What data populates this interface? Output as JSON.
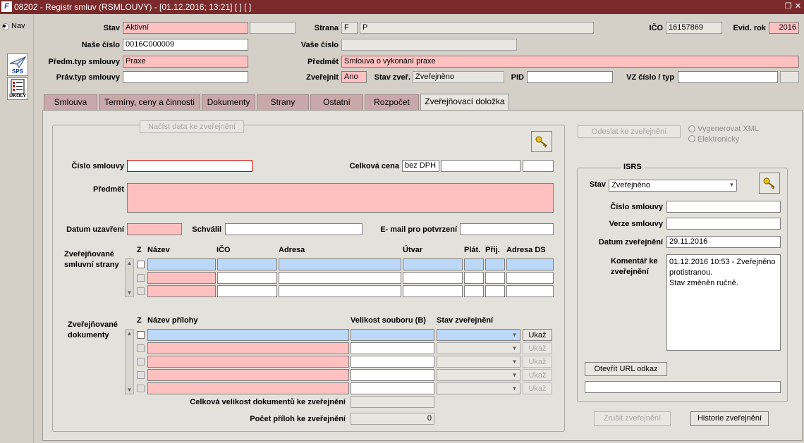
{
  "window": {
    "title": "08202 - Registr smluv (RSMLOUVY) - [01.12.2016; 13:21] [ ] [ ]",
    "app_icon_text": "F"
  },
  "left": {
    "nav_label": "Nav",
    "sps_label": "SPS",
    "ukoly_label": "ÚKOLY"
  },
  "header": {
    "stav_label": "Stav",
    "stav_value": "Aktivní",
    "strana_label": "Strana",
    "strana_code": "F",
    "strana_value": "P",
    "ico_label": "IČO",
    "ico_value": "16157869",
    "evid_rok_label": "Evid. rok",
    "evid_rok_value": "2016",
    "nase_cislo_label": "Naše číslo",
    "nase_cislo_value": "0016C000009",
    "vase_cislo_label": "Vaše číslo",
    "predm_typ_label": "Předm.typ smlouvy",
    "predm_typ_value": "Praxe",
    "predmet_label": "Předmět",
    "predmet_value": "Smlouva o vykonání praxe",
    "prav_typ_label": "Práv.typ smlouvy",
    "zverejnit_label": "Zveřejnit",
    "zverejnit_value": "Ano",
    "stav_zver_label": "Stav zveř.",
    "stav_zver_value": "Zveřejněno",
    "pid_label": "PID",
    "vz_label": "VZ číslo / typ"
  },
  "tabs": [
    {
      "label": "Smlouva"
    },
    {
      "label": "Termíny, ceny a činnosti"
    },
    {
      "label": "Dokumenty"
    },
    {
      "label": "Strany"
    },
    {
      "label": "Ostatní"
    },
    {
      "label": "Rozpočet"
    },
    {
      "label": "Zveřejňovací doložka"
    }
  ],
  "form": {
    "load_button": "Načíst data ke zveřejnění",
    "cislo_smlouvy_label": "Číslo smlouvy",
    "celkova_cena_label": "Celková cena",
    "celkova_cena_dph": "bez DPH",
    "predmet_label": "Předmět",
    "datum_uzavreni_label": "Datum uzavření",
    "schvalil_label": "Schválil",
    "email_label": "E- mail pro potvrzení",
    "strany_label": "Zveřejňované smluvní strany",
    "strany_columns": [
      "Z",
      "Název",
      "IČO",
      "Adresa",
      "Útvar",
      "Plát.",
      "Přij.",
      "Adresa DS"
    ],
    "dokumenty_label": "Zveřejňované dokumenty",
    "dokumenty_columns": [
      "Z",
      "Název přílohy",
      "Velikost souboru (B)",
      "Stav zveřejnění"
    ],
    "ukaz_label": "Ukaž",
    "celkova_velikost_label": "Celková velikost dokumentů ke zveřejnění",
    "pocet_priloh_label": "Počet příloh ke zveřejnění",
    "pocet_priloh_value": "0"
  },
  "right": {
    "odeslat_button": "Odeslat ke zveřejnění",
    "vygenerovat_label": "Vygenerovat XML",
    "elektronicky_label": "Elektronicky",
    "isrs_title": "ISRS",
    "stav_label": "Stav",
    "stav_value": "Zveřejněno",
    "cislo_smlouvy_label": "Číslo smlouvy",
    "verze_label": "Verze smlouvy",
    "datum_zver_label": "Datum zveřejnění",
    "datum_zver_value": "29.11.2016",
    "komentar_label": "Komentář ke zveřejnění",
    "komentar_value": "01.12.2016 10:53 - Zveřejněno protistranou.\nStav změněn ručně.",
    "otevrit_url_button": "Otevřít URL odkaz",
    "zrusit_button": "Zrušit zveřejnění",
    "historie_button": "Historie zveřejnění"
  }
}
